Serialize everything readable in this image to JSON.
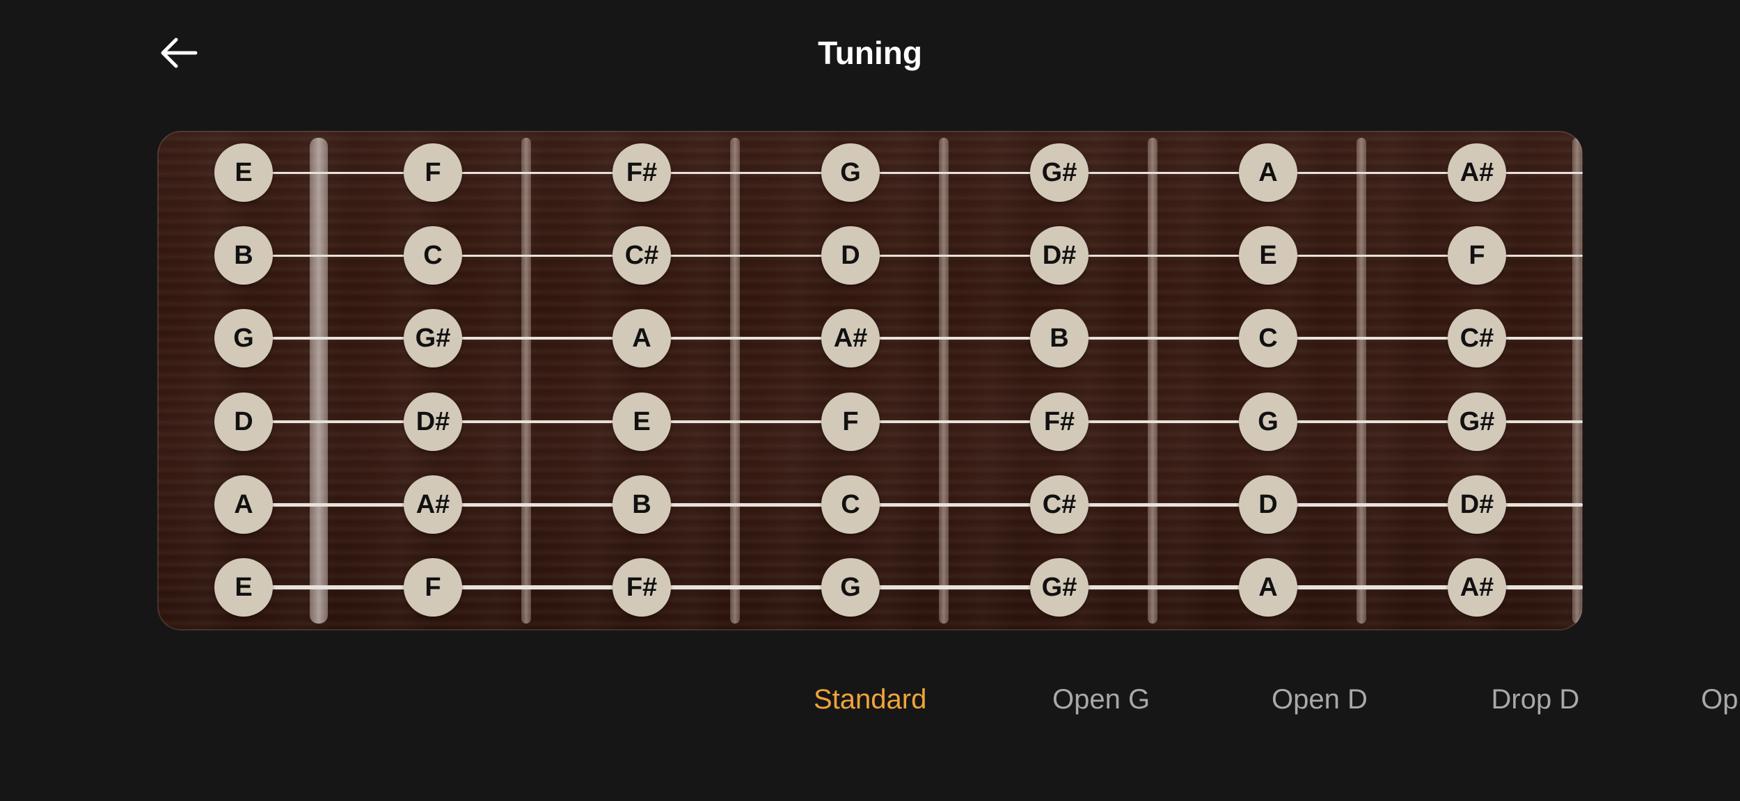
{
  "header": {
    "title": "Tuning",
    "back_icon": "arrow-left-icon"
  },
  "fretboard": {
    "rows": [
      [
        "E",
        "F",
        "F#",
        "G",
        "G#",
        "A",
        "A#"
      ],
      [
        "B",
        "C",
        "C#",
        "D",
        "D#",
        "E",
        "F"
      ],
      [
        "G",
        "G#",
        "A",
        "A#",
        "B",
        "C",
        "C#"
      ],
      [
        "D",
        "D#",
        "E",
        "F",
        "F#",
        "G",
        "G#"
      ],
      [
        "A",
        "A#",
        "B",
        "C",
        "C#",
        "D",
        "D#"
      ],
      [
        "E",
        "F",
        "F#",
        "G",
        "G#",
        "A",
        "A#"
      ]
    ]
  },
  "tunings": {
    "items": [
      "Standard",
      "Open G",
      "Open D",
      "Drop D",
      "Op"
    ],
    "selected": "Standard"
  },
  "colors": {
    "accent": "#f0a43a",
    "background": "#161616",
    "note_fill": "#d3c9b9",
    "inactive_tab": "#a9a9a9"
  }
}
